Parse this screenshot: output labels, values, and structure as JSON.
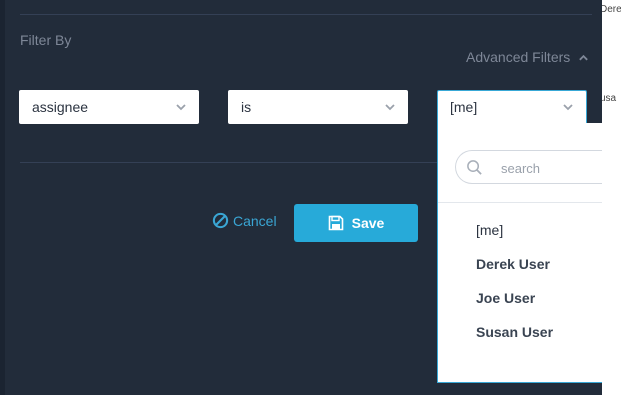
{
  "right_peek": {
    "line1": "Dere",
    "line2": "usa"
  },
  "filter": {
    "title": "Filter By",
    "advanced_label": "Advanced Filters",
    "field_select": {
      "value": "assignee"
    },
    "operator_select": {
      "value": "is"
    },
    "value_select": {
      "value": "[me]"
    }
  },
  "actions": {
    "cancel_label": "Cancel",
    "save_label": "Save"
  },
  "dropdown": {
    "search_placeholder": "search",
    "options": [
      "[me]",
      "Derek User",
      "Joe User",
      "Susan User"
    ]
  },
  "colors": {
    "background": "#222c3a",
    "accent": "#27aad9",
    "link": "#3aa6d4"
  }
}
